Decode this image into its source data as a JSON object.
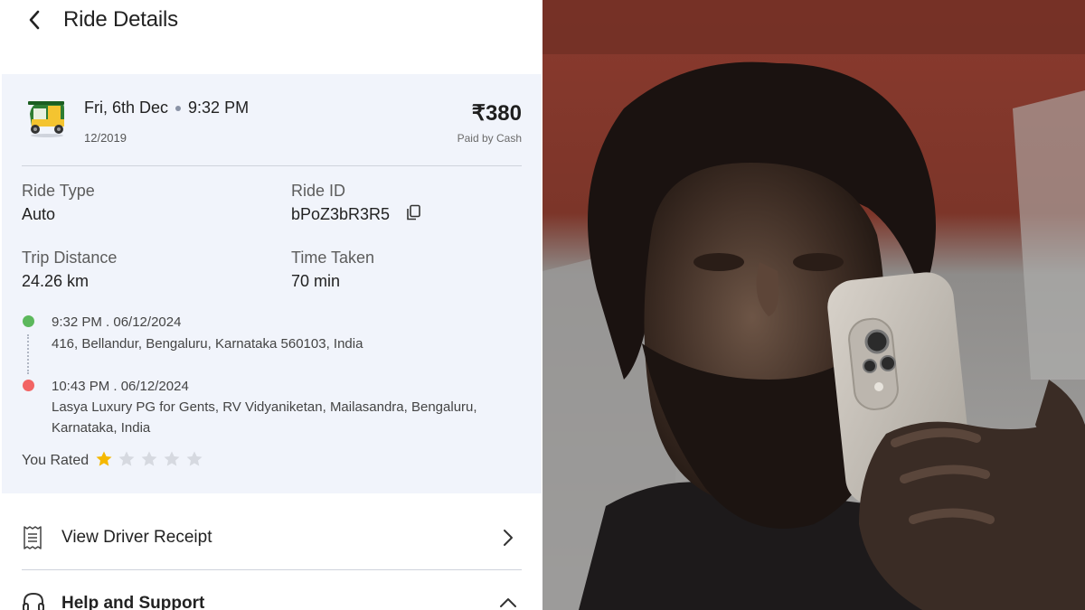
{
  "header": {
    "title": "Ride Details"
  },
  "ride": {
    "date": "Fri, 6th Dec",
    "time": "9:32 PM",
    "sub_date": "12/2019",
    "price": "₹380",
    "payment": "Paid by Cash",
    "ride_type_label": "Ride Type",
    "ride_type": "Auto",
    "ride_id_label": "Ride ID",
    "ride_id": "bPoZ3bR3R5",
    "distance_label": "Trip Distance",
    "distance": "24.26 km",
    "time_taken_label": "Time Taken",
    "time_taken": "70 min"
  },
  "route": {
    "pickup_time": "9:32 PM . 06/12/2024",
    "pickup_address": "416, Bellandur, Bengaluru, Karnataka 560103, India",
    "drop_time": "10:43 PM . 06/12/2024",
    "drop_address": "Lasya Luxury PG for Gents, RV Vidyaniketan, Mailasandra, Bengaluru, Karnataka, India",
    "pickup_color": "#5cb85c",
    "drop_color": "#f26464"
  },
  "rating": {
    "label": "You Rated",
    "value": 1,
    "max": 5,
    "filled_color": "#f5b800",
    "empty_color": "#d6d9e0"
  },
  "actions": {
    "receipt_label": "View Driver Receipt",
    "help_label": "Help and Support"
  },
  "photo": {
    "icon": "person-photo"
  }
}
